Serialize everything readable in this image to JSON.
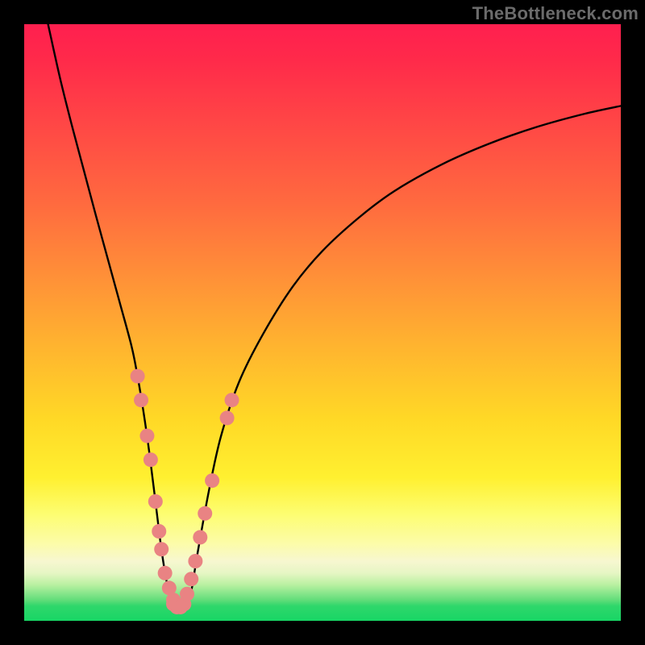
{
  "watermark": "TheBottleneck.com",
  "colors": {
    "curve": "#000000",
    "dot_fill": "#e98383",
    "dot_stroke": "#c96a6a",
    "frame": "#000000"
  },
  "chart_data": {
    "type": "line",
    "title": "",
    "xlabel": "",
    "ylabel": "",
    "xlim": [
      0,
      100
    ],
    "ylim": [
      0,
      100
    ],
    "curve": {
      "x": [
        4,
        6,
        8,
        10,
        12,
        14,
        16,
        18,
        19,
        20,
        21,
        22,
        23,
        24,
        25,
        26,
        27,
        28,
        29,
        31,
        33,
        36,
        40,
        45,
        50,
        56,
        62,
        70,
        78,
        86,
        94,
        100
      ],
      "y": [
        100,
        91,
        83,
        75.5,
        68,
        60.7,
        53.4,
        46,
        41,
        35,
        28,
        20,
        12,
        6,
        3,
        2.2,
        2.5,
        5,
        11,
        22,
        31,
        40,
        48,
        56,
        62,
        67.5,
        72,
        76.5,
        80,
        82.8,
        85,
        86.3
      ]
    },
    "series": [
      {
        "name": "left-arm-dots",
        "kind": "scatter",
        "x": [
          19.0,
          19.6,
          20.6,
          21.2,
          22.0,
          22.6,
          23.0,
          23.6,
          24.3,
          25.0,
          25.8
        ],
        "y": [
          41.0,
          37.0,
          31.0,
          27.0,
          20.0,
          15.0,
          12.0,
          8.0,
          5.5,
          3.5,
          2.5
        ]
      },
      {
        "name": "valley-dots",
        "kind": "scatter",
        "x": [
          25.0,
          25.6,
          26.2,
          26.8
        ],
        "y": [
          2.8,
          2.3,
          2.3,
          2.8
        ]
      },
      {
        "name": "right-arm-dots",
        "kind": "scatter",
        "x": [
          27.3,
          28.0,
          28.7,
          29.5,
          30.3,
          31.5,
          34.0,
          34.8
        ],
        "y": [
          4.5,
          7.0,
          10.0,
          14.0,
          18.0,
          23.5,
          34.0,
          37.0
        ]
      }
    ],
    "dot_radius_px": 9
  }
}
